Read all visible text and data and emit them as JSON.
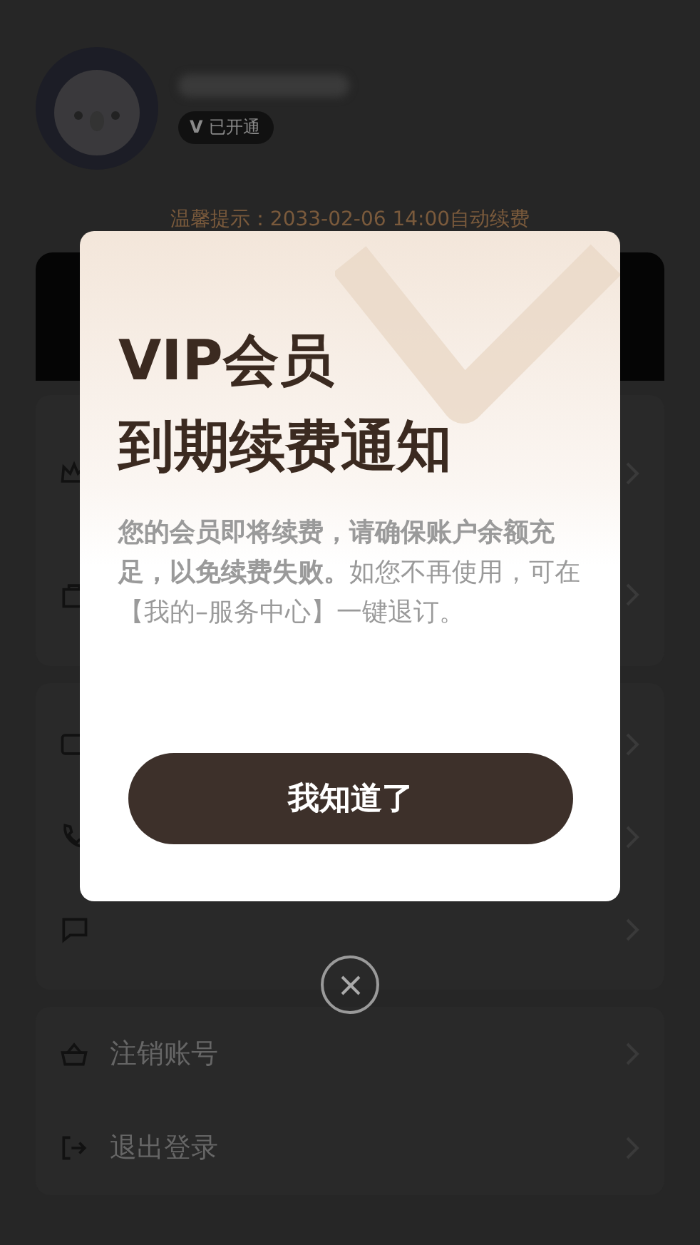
{
  "profile": {
    "badge": {
      "mark": "V",
      "label": "已开通"
    }
  },
  "reminder": "温馨提示：2033-02-06 14:00自动续费",
  "account_menu": [
    {
      "label": "注销账号"
    },
    {
      "label": "退出登录"
    }
  ],
  "dialog": {
    "title_lines": [
      "VIP会员",
      "到期续费通知"
    ],
    "message": "**您的会员即将续费，请确保账户余额充足，以免续费失败。**如您不再使用，可在【我的–服务中心】一键退订。",
    "button": "我知道了",
    "closable": true
  }
}
